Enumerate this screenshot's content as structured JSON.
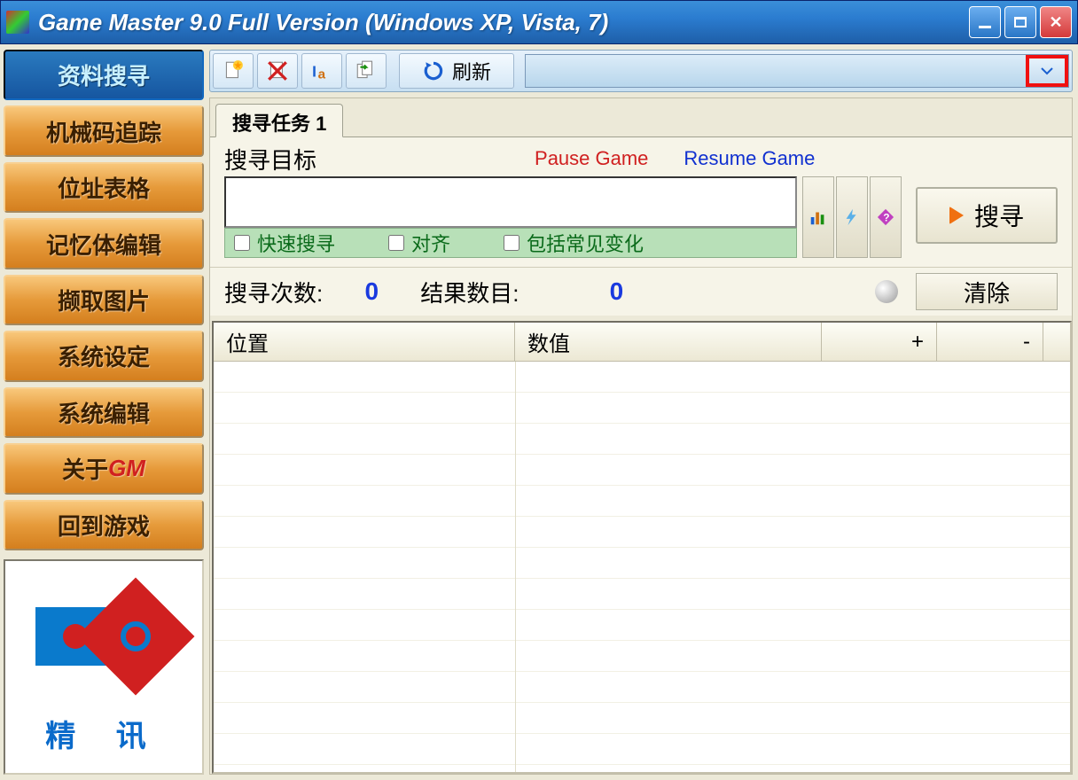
{
  "window": {
    "title": "Game Master 9.0 Full Version (Windows XP, Vista, 7)"
  },
  "sidebar": {
    "items": [
      "资料搜寻",
      "机械码追踪",
      "位址表格",
      "记忆体编辑",
      "撷取图片",
      "系统设定",
      "系统编辑",
      "关于 ",
      "回到游戏"
    ],
    "gm_suffix": "GM",
    "logo_text": "精 讯"
  },
  "toolbar": {
    "refresh": "刷新"
  },
  "tabs": {
    "task1": "搜寻任务 1"
  },
  "search": {
    "target_label": "搜寻目标",
    "pause": "Pause Game",
    "resume": "Resume Game",
    "input_value": "",
    "opt_quick": "快速搜寻",
    "opt_align": "对齐",
    "opt_include": "包括常见变化",
    "search_btn": "搜寻"
  },
  "counts": {
    "count_label": "搜寻次数:",
    "count_val": "0",
    "result_label": "结果数目:",
    "result_val": "0",
    "clear": "清除"
  },
  "grid": {
    "col_location": "位置",
    "col_value": "数值",
    "col_plus": "+",
    "col_minus": "-"
  }
}
